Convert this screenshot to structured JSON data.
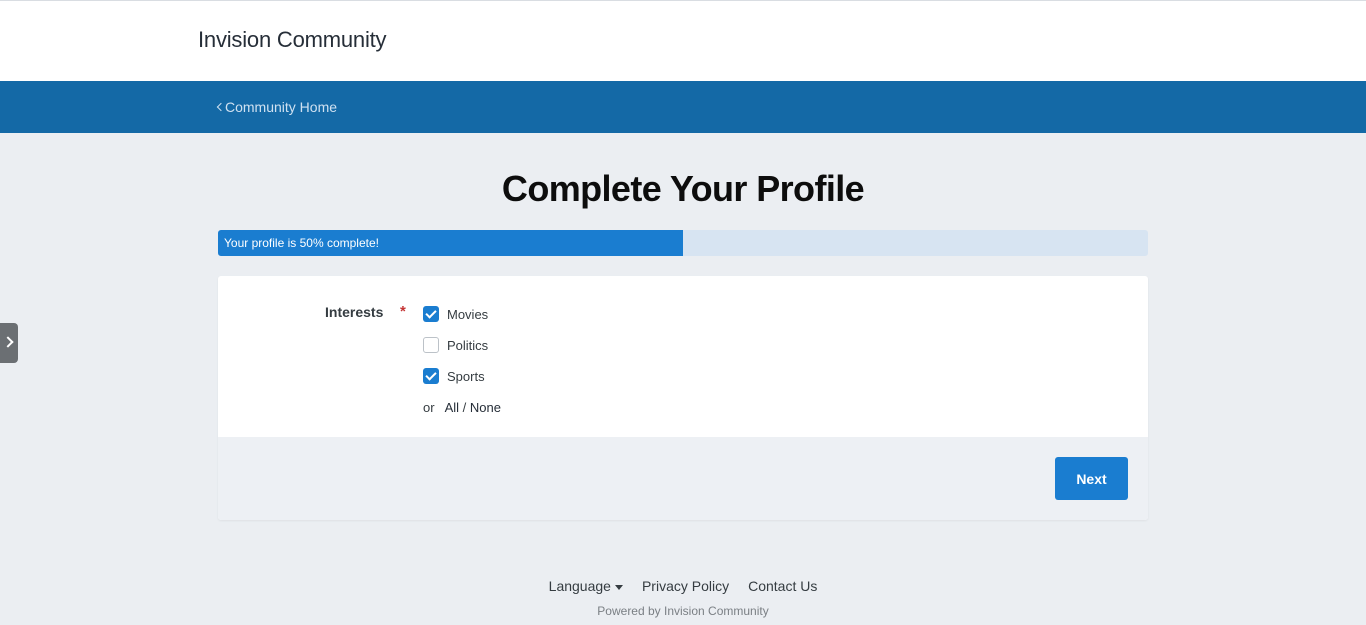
{
  "header": {
    "site_title": "Invision Community"
  },
  "navbar": {
    "back_link": "Community Home"
  },
  "page": {
    "title": "Complete Your Profile"
  },
  "progress": {
    "text": "Your profile is 50% complete!",
    "percent": 50
  },
  "form": {
    "field_label": "Interests",
    "required_mark": "*",
    "options": [
      {
        "label": "Movies",
        "checked": true
      },
      {
        "label": "Politics",
        "checked": false
      },
      {
        "label": "Sports",
        "checked": true
      }
    ],
    "or_text": "or",
    "all_label": "All",
    "separator": "/",
    "none_label": "None",
    "submit_label": "Next"
  },
  "footer": {
    "language_label": "Language",
    "privacy_label": "Privacy Policy",
    "contact_label": "Contact Us",
    "powered_by": "Powered by Invision Community"
  },
  "colors": {
    "accent": "#1a7dd0",
    "navbar": "#1469a6",
    "background": "#ebeef2",
    "required": "#c43434"
  },
  "icons": {
    "back": "chevron-left-icon",
    "side_tab": "chevron-right-icon",
    "checkbox_checked": "check-icon",
    "language": "caret-down-icon"
  }
}
